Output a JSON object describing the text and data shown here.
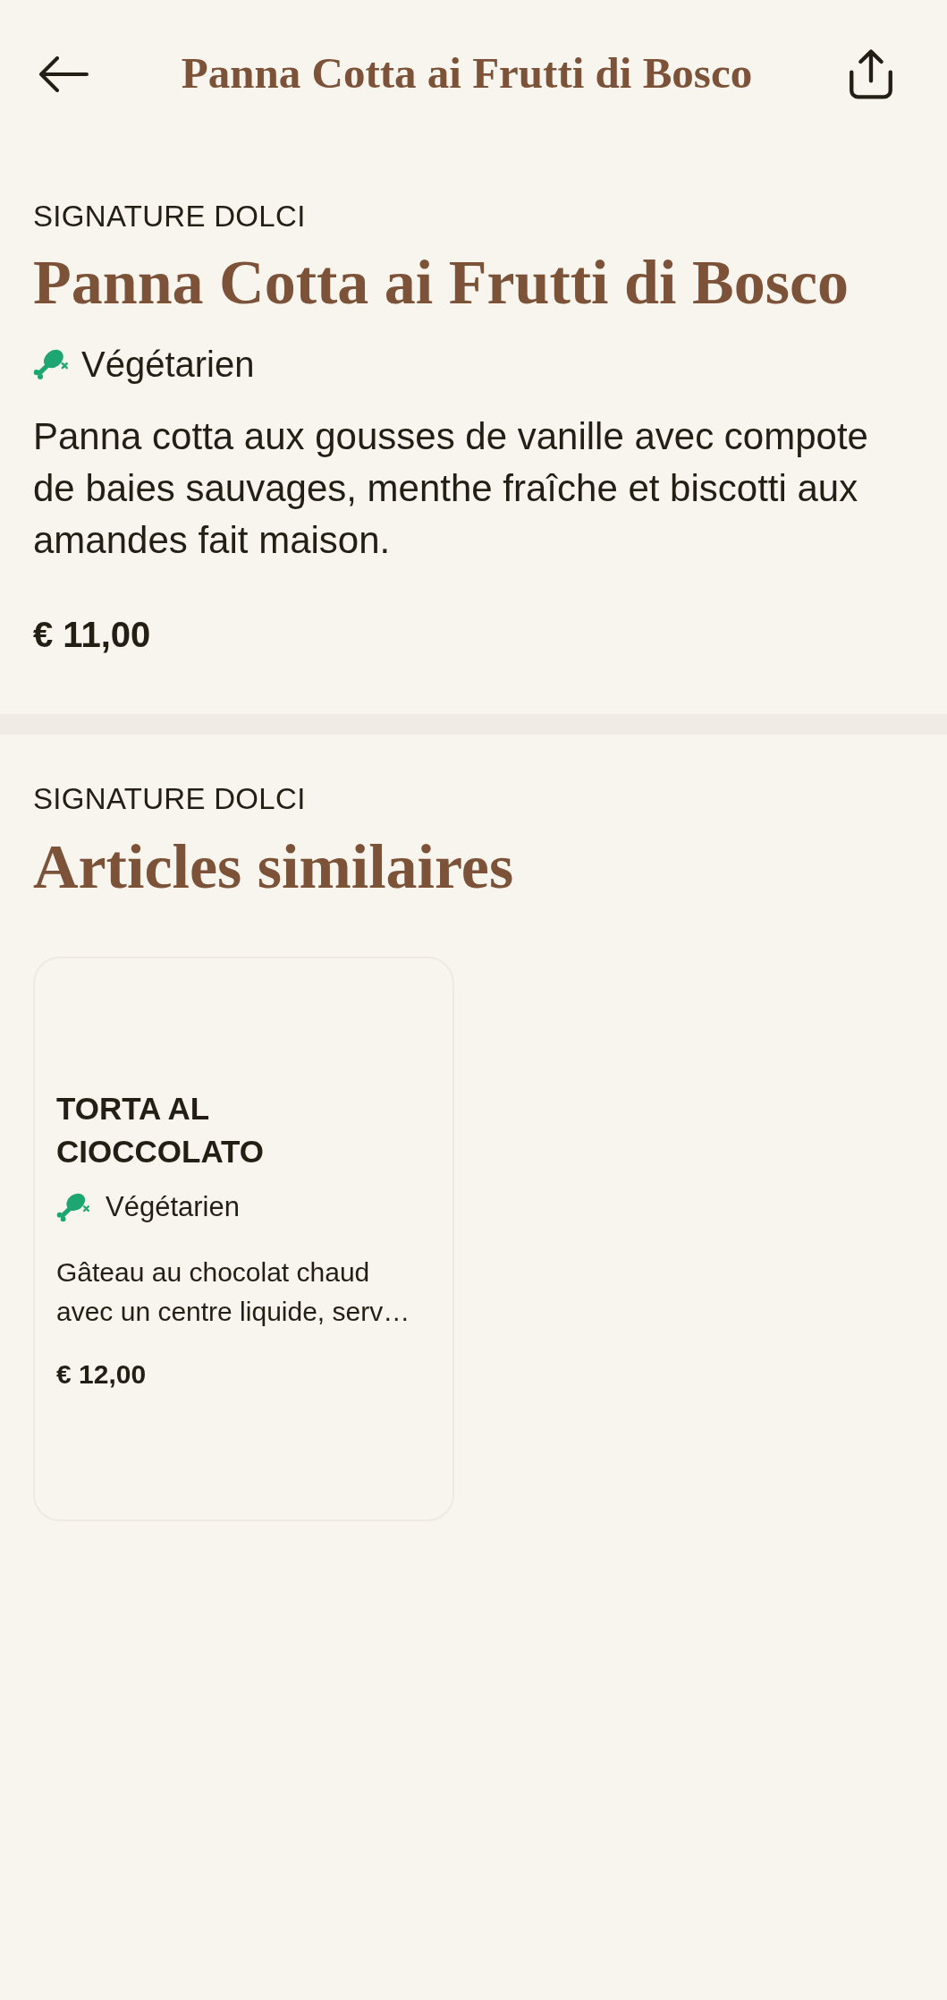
{
  "header": {
    "title": "Panna Cotta ai Frutti di Bosco"
  },
  "item": {
    "category": "SIGNATURE DOLCI",
    "name": "Panna Cotta ai Frutti di Bosco",
    "tags": [
      {
        "kind": "vegetarian",
        "label": "Végétarien"
      }
    ],
    "description": "Panna cotta aux gousses de vanille avec compote de baies sauvages, menthe fraîche et biscotti aux amandes fait maison.",
    "price": "€ 11,00"
  },
  "similar": {
    "category": "SIGNATURE DOLCI",
    "title": "Articles similaires",
    "items": [
      {
        "name": "TORTA AL CIOCCOLATO",
        "tags": [
          {
            "kind": "vegetarian",
            "label": "Végétarien"
          }
        ],
        "description": "Gâteau au chocolat chaud avec un centre liquide, serv…",
        "price": "€ 12,00"
      }
    ]
  }
}
